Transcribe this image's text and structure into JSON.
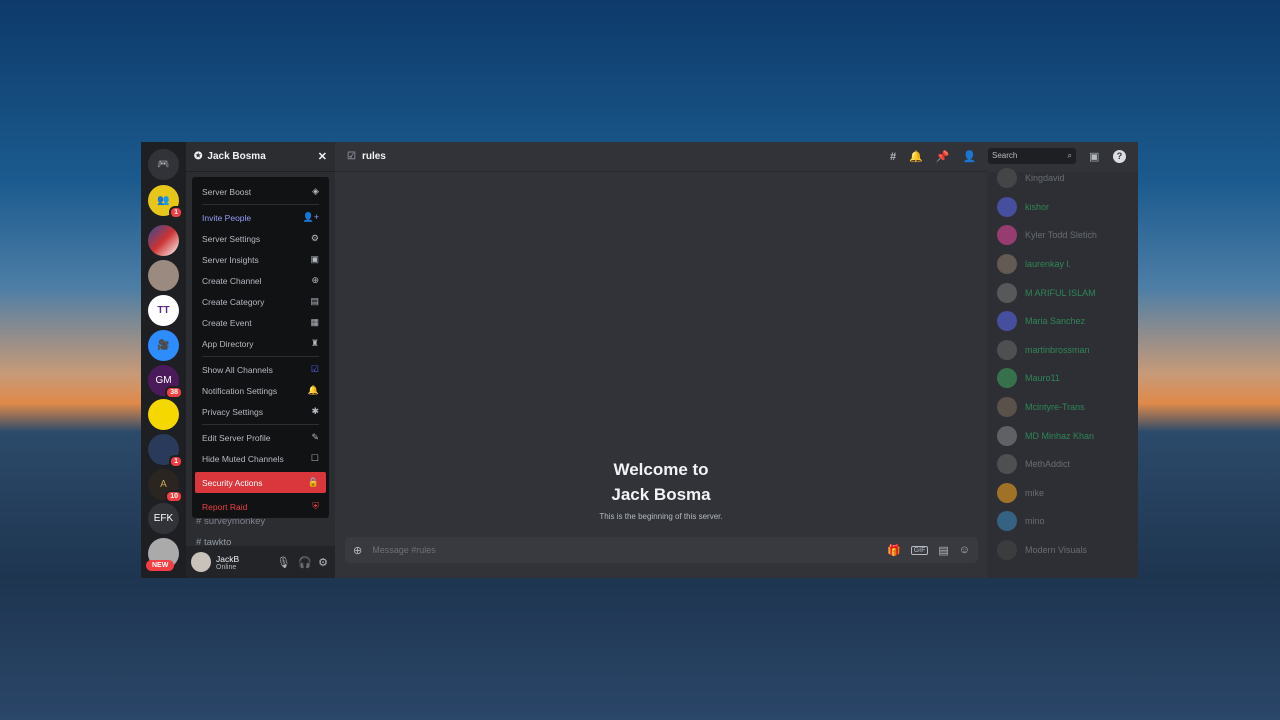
{
  "server": {
    "name": "Jack Bosma",
    "close": "✕"
  },
  "rail": {
    "efk": "EFK",
    "new_badge": "NEW",
    "badges": [
      "1",
      "38",
      "1",
      "10"
    ],
    "tt": "TT",
    "gm": "GM"
  },
  "menu": {
    "items": [
      {
        "label": "Server Boost",
        "icon": "◈",
        "color": "#b5bac1"
      },
      {
        "label": "Invite People",
        "icon": "👤+",
        "color": "#949cf7"
      },
      {
        "label": "Server Settings",
        "icon": "⚙",
        "color": "#b5bac1"
      },
      {
        "label": "Server Insights",
        "icon": "▣",
        "color": "#b5bac1"
      },
      {
        "label": "Create Channel",
        "icon": "⊕",
        "color": "#b5bac1"
      },
      {
        "label": "Create Category",
        "icon": "▤",
        "color": "#b5bac1"
      },
      {
        "label": "Create Event",
        "icon": "▦",
        "color": "#b5bac1"
      },
      {
        "label": "App Directory",
        "icon": "♜",
        "color": "#b5bac1"
      },
      {
        "label": "Show All Channels",
        "icon": "☑",
        "color": "#b5bac1"
      },
      {
        "label": "Notification Settings",
        "icon": "🔔",
        "color": "#b5bac1"
      },
      {
        "label": "Privacy Settings",
        "icon": "✱",
        "color": "#b5bac1"
      },
      {
        "label": "Edit Server Profile",
        "icon": "✎",
        "color": "#b5bac1"
      },
      {
        "label": "Hide Muted Channels",
        "icon": "☐",
        "color": "#b5bac1"
      },
      {
        "label": "Security Actions",
        "icon": "🔒",
        "color": "#ffffff"
      },
      {
        "label": "Report Raid",
        "icon": "⛨",
        "color": "#f23f43"
      }
    ]
  },
  "channels": [
    "surveymonkey",
    "tawkto"
  ],
  "user": {
    "name": "JackB",
    "status": "Online"
  },
  "header": {
    "channel": "rules",
    "search_placeholder": "Search"
  },
  "welcome": {
    "title_line1": "Welcome to",
    "title_line2": "Jack Bosma",
    "subtitle": "This is the beginning of this server."
  },
  "composer": {
    "placeholder": "Message #rules",
    "gif": "GIF"
  },
  "members": [
    {
      "name": "Kingdavid",
      "color": "#949ba4",
      "avatar": "#555"
    },
    {
      "name": "kishor",
      "color": "#2dc770",
      "avatar": "#5865f2"
    },
    {
      "name": "Kyler Todd Sletich",
      "color": "#949ba4",
      "avatar": "#eb459e"
    },
    {
      "name": "laurenkay l.",
      "color": "#2dc770",
      "avatar": "#8a7a6a"
    },
    {
      "name": "M ARIFUL ISLAM",
      "color": "#2dc770",
      "avatar": "#777"
    },
    {
      "name": "Maria Sanchez",
      "color": "#2dc770",
      "avatar": "#5865f2"
    },
    {
      "name": "martinbrossman",
      "color": "#2dc770",
      "avatar": "#666"
    },
    {
      "name": "Mauro11",
      "color": "#2dc770",
      "avatar": "#3ba55c"
    },
    {
      "name": "Mcintyre-Trans",
      "color": "#2dc770",
      "avatar": "#7a6a5a"
    },
    {
      "name": "MD Minhaz Khan",
      "color": "#2dc770",
      "avatar": "#888"
    },
    {
      "name": "MethAddict",
      "color": "#949ba4",
      "avatar": "#666"
    },
    {
      "name": "mike",
      "color": "#949ba4",
      "avatar": "#faa61a"
    },
    {
      "name": "mino",
      "color": "#949ba4",
      "avatar": "#3a8ac0"
    },
    {
      "name": "Modern Visuals",
      "color": "#949ba4",
      "avatar": "#444"
    }
  ]
}
